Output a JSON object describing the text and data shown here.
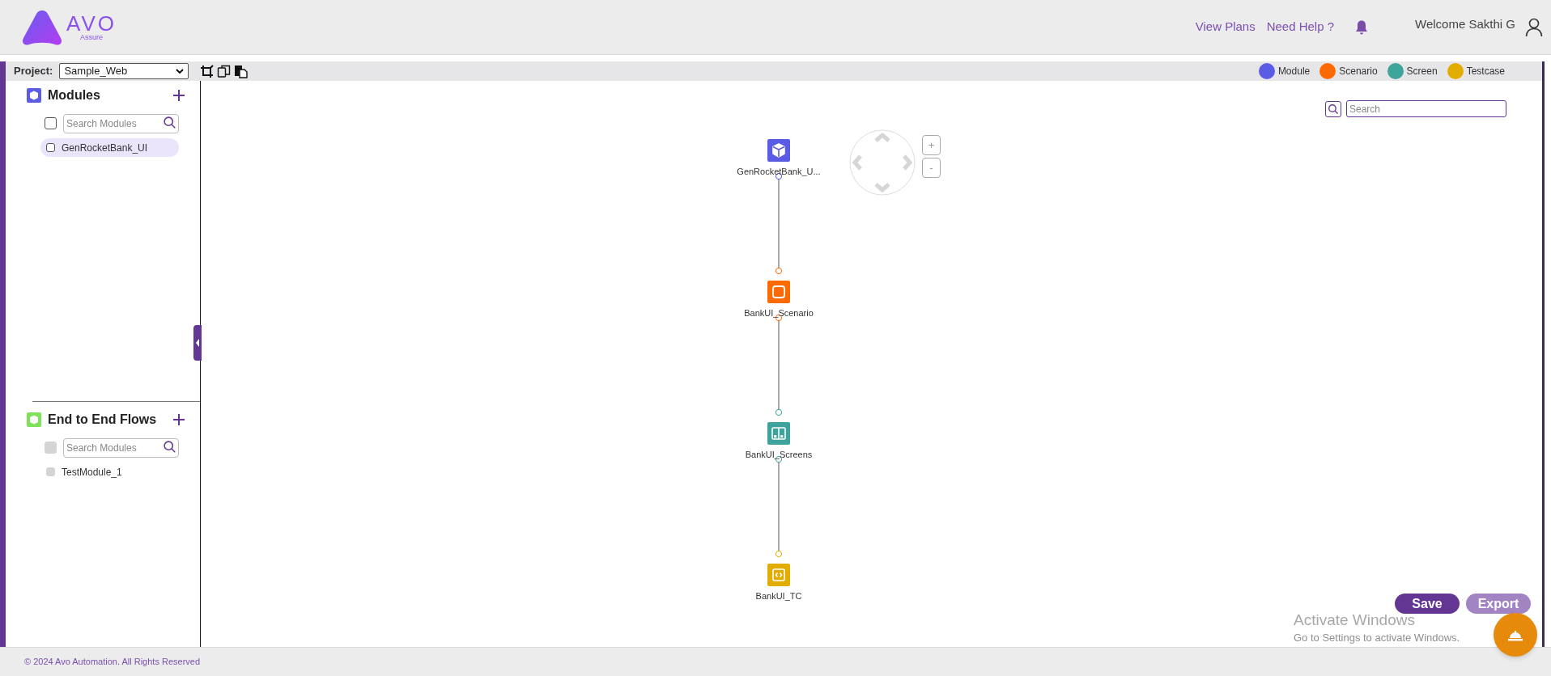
{
  "header": {
    "logo": {
      "wordmark": "AVO",
      "tagline": "Assure"
    },
    "links": [
      "View Plans",
      "Need Help ?"
    ],
    "welcome": "Welcome Sakthi G"
  },
  "toolbar": {
    "project_label": "Project:",
    "project": "Sample_Web"
  },
  "legend": [
    {
      "label": "Module",
      "color": "#5b5ce6"
    },
    {
      "label": "Scenario",
      "color": "#ff6a00"
    },
    {
      "label": "Screen",
      "color": "#3ea39b"
    },
    {
      "label": "Testcase",
      "color": "#e2ad00"
    }
  ],
  "modules": {
    "title": "Modules",
    "select_all": {
      "checked": false,
      "disabled": false
    },
    "search": {
      "placeholder": "Search Modules"
    },
    "items": [
      {
        "label": "GenRocketBank_UI",
        "checked": false,
        "selected": true,
        "disabled": false
      }
    ]
  },
  "flows": {
    "title": "End to End Flows",
    "select_all": {
      "checked": false,
      "disabled": true
    },
    "search": {
      "placeholder": "Search Modules"
    },
    "items": [
      {
        "label": "TestModule_1",
        "checked": false,
        "selected": false,
        "disabled": true
      }
    ]
  },
  "canvas": {
    "search": {
      "placeholder": "Search"
    },
    "zoom_buttons": [
      "+",
      "-"
    ],
    "nodes": [
      {
        "kind": "module",
        "label": "GenRocketBank_U...",
        "color": "#5b5ce6"
      },
      {
        "kind": "scenario",
        "label": "BankUI_Scenario",
        "color": "#ff6a00"
      },
      {
        "kind": "screen",
        "label": "BankUI_Screens",
        "color": "#3ea39b"
      },
      {
        "kind": "testcase",
        "label": "BankUI_TC",
        "color": "#e2ad00"
      }
    ]
  },
  "actions": [
    {
      "label": "Save",
      "disabled": false
    },
    {
      "label": "Export",
      "disabled": true
    }
  ],
  "os_notice": {
    "title": "Activate Windows",
    "text": "Go to Settings to activate Windows."
  },
  "footer": "© 2024 Avo Automation. All Rights Reserved"
}
